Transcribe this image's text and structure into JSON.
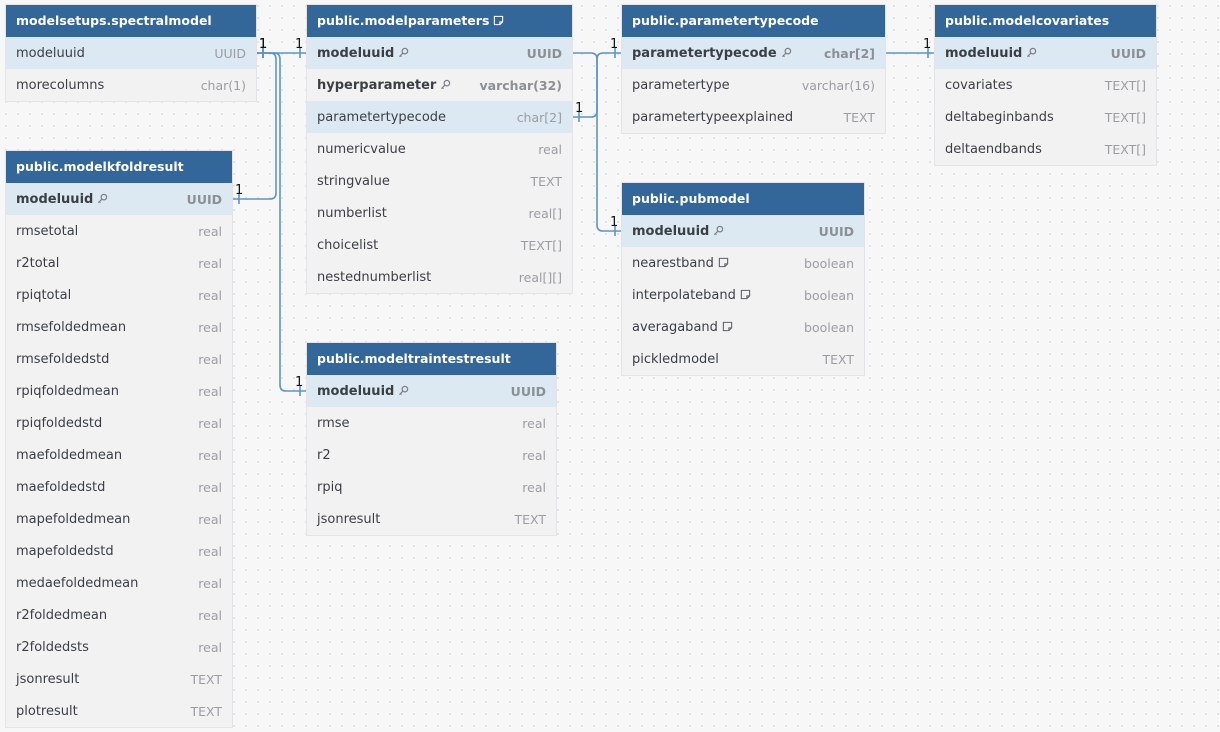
{
  "colors": {
    "header": "#336699",
    "key_row": "#dde9f2",
    "line": "#5b95c8"
  },
  "tables": [
    {
      "id": "spectralmodel",
      "title": "modelsetups.spectralmodel",
      "note": false,
      "columns": [
        {
          "name": "modeluuid",
          "type": "UUID",
          "key": false,
          "bold": false,
          "highlight": true,
          "note": false
        },
        {
          "name": "morecolumns",
          "type": "char(1)",
          "key": false,
          "bold": false,
          "highlight": false,
          "note": false
        }
      ]
    },
    {
      "id": "modelparameters",
      "title": "public.modelparameters",
      "note": true,
      "columns": [
        {
          "name": "modeluuid",
          "type": "UUID",
          "key": true,
          "bold": true,
          "highlight": true,
          "note": false
        },
        {
          "name": "hyperparameter",
          "type": "varchar(32)",
          "key": true,
          "bold": true,
          "highlight": false,
          "note": false
        },
        {
          "name": "parametertypecode",
          "type": "char[2]",
          "key": false,
          "bold": false,
          "highlight": true,
          "note": false
        },
        {
          "name": "numericvalue",
          "type": "real",
          "key": false,
          "bold": false,
          "highlight": false,
          "note": false
        },
        {
          "name": "stringvalue",
          "type": "TEXT",
          "key": false,
          "bold": false,
          "highlight": false,
          "note": false
        },
        {
          "name": "numberlist",
          "type": "real[]",
          "key": false,
          "bold": false,
          "highlight": false,
          "note": false
        },
        {
          "name": "choicelist",
          "type": "TEXT[]",
          "key": false,
          "bold": false,
          "highlight": false,
          "note": false
        },
        {
          "name": "nestednumberlist",
          "type": "real[][]",
          "key": false,
          "bold": false,
          "highlight": false,
          "note": false
        }
      ]
    },
    {
      "id": "parametertypecode",
      "title": "public.parametertypecode",
      "note": false,
      "columns": [
        {
          "name": "parametertypecode",
          "type": "char[2]",
          "key": true,
          "bold": true,
          "highlight": true,
          "note": false
        },
        {
          "name": "parametertype",
          "type": "varchar(16)",
          "key": false,
          "bold": false,
          "highlight": false,
          "note": false
        },
        {
          "name": "parametertypeexplained",
          "type": "TEXT",
          "key": false,
          "bold": false,
          "highlight": false,
          "note": false
        }
      ]
    },
    {
      "id": "modelcovariates",
      "title": "public.modelcovariates",
      "note": false,
      "columns": [
        {
          "name": "modeluuid",
          "type": "UUID",
          "key": true,
          "bold": true,
          "highlight": true,
          "note": false
        },
        {
          "name": "covariates",
          "type": "TEXT[]",
          "key": false,
          "bold": false,
          "highlight": false,
          "note": false
        },
        {
          "name": "deltabeginbands",
          "type": "TEXT[]",
          "key": false,
          "bold": false,
          "highlight": false,
          "note": false
        },
        {
          "name": "deltaendbands",
          "type": "TEXT[]",
          "key": false,
          "bold": false,
          "highlight": false,
          "note": false
        }
      ]
    },
    {
      "id": "modelkfoldresult",
      "title": "public.modelkfoldresult",
      "note": false,
      "columns": [
        {
          "name": "modeluuid",
          "type": "UUID",
          "key": true,
          "bold": true,
          "highlight": true,
          "note": false
        },
        {
          "name": "rmsetotal",
          "type": "real",
          "key": false,
          "bold": false,
          "highlight": false,
          "note": false
        },
        {
          "name": "r2total",
          "type": "real",
          "key": false,
          "bold": false,
          "highlight": false,
          "note": false
        },
        {
          "name": "rpiqtotal",
          "type": "real",
          "key": false,
          "bold": false,
          "highlight": false,
          "note": false
        },
        {
          "name": "rmsefoldedmean",
          "type": "real",
          "key": false,
          "bold": false,
          "highlight": false,
          "note": false
        },
        {
          "name": "rmsefoldedstd",
          "type": "real",
          "key": false,
          "bold": false,
          "highlight": false,
          "note": false
        },
        {
          "name": "rpiqfoldedmean",
          "type": "real",
          "key": false,
          "bold": false,
          "highlight": false,
          "note": false
        },
        {
          "name": "rpiqfoldedstd",
          "type": "real",
          "key": false,
          "bold": false,
          "highlight": false,
          "note": false
        },
        {
          "name": "maefoldedmean",
          "type": "real",
          "key": false,
          "bold": false,
          "highlight": false,
          "note": false
        },
        {
          "name": "maefoldedstd",
          "type": "real",
          "key": false,
          "bold": false,
          "highlight": false,
          "note": false
        },
        {
          "name": "mapefoldedmean",
          "type": "real",
          "key": false,
          "bold": false,
          "highlight": false,
          "note": false
        },
        {
          "name": "mapefoldedstd",
          "type": "real",
          "key": false,
          "bold": false,
          "highlight": false,
          "note": false
        },
        {
          "name": "medaefoldedmean",
          "type": "real",
          "key": false,
          "bold": false,
          "highlight": false,
          "note": false
        },
        {
          "name": "r2foldedmean",
          "type": "real",
          "key": false,
          "bold": false,
          "highlight": false,
          "note": false
        },
        {
          "name": "r2foldedsts",
          "type": "real",
          "key": false,
          "bold": false,
          "highlight": false,
          "note": false
        },
        {
          "name": "jsonresult",
          "type": "TEXT",
          "key": false,
          "bold": false,
          "highlight": false,
          "note": false
        },
        {
          "name": "plotresult",
          "type": "TEXT",
          "key": false,
          "bold": false,
          "highlight": false,
          "note": false
        }
      ]
    },
    {
      "id": "pubmodel",
      "title": "public.pubmodel",
      "note": false,
      "columns": [
        {
          "name": "modeluuid",
          "type": "UUID",
          "key": true,
          "bold": true,
          "highlight": true,
          "note": false
        },
        {
          "name": "nearestband",
          "type": "boolean",
          "key": false,
          "bold": false,
          "highlight": false,
          "note": true
        },
        {
          "name": "interpolateband",
          "type": "boolean",
          "key": false,
          "bold": false,
          "highlight": false,
          "note": true
        },
        {
          "name": "averagaband",
          "type": "boolean",
          "key": false,
          "bold": false,
          "highlight": false,
          "note": true
        },
        {
          "name": "pickledmodel",
          "type": "TEXT",
          "key": false,
          "bold": false,
          "highlight": false,
          "note": false
        }
      ]
    },
    {
      "id": "modeltraintestresult",
      "title": "public.modeltraintestresult",
      "note": false,
      "columns": [
        {
          "name": "modeluuid",
          "type": "UUID",
          "key": true,
          "bold": true,
          "highlight": true,
          "note": false
        },
        {
          "name": "rmse",
          "type": "real",
          "key": false,
          "bold": false,
          "highlight": false,
          "note": false
        },
        {
          "name": "r2",
          "type": "real",
          "key": false,
          "bold": false,
          "highlight": false,
          "note": false
        },
        {
          "name": "rpiq",
          "type": "real",
          "key": false,
          "bold": false,
          "highlight": false,
          "note": false
        },
        {
          "name": "jsonresult",
          "type": "TEXT",
          "key": false,
          "bold": false,
          "highlight": false,
          "note": false
        }
      ]
    }
  ],
  "relations": [
    {
      "from": "spectralmodel",
      "from_col": "modeluuid",
      "to": "modelparameters",
      "to_col": "modeluuid",
      "from_card": "1",
      "to_card": "1"
    },
    {
      "from": "spectralmodel",
      "from_col": "modeluuid",
      "to": "modelkfoldresult",
      "to_col": "modeluuid",
      "from_card": "1",
      "to_card": "1"
    },
    {
      "from": "spectralmodel",
      "from_col": "modeluuid",
      "to": "modeltraintestresult",
      "to_col": "modeluuid",
      "from_card": "1",
      "to_card": "1"
    },
    {
      "from": "modelparameters",
      "from_col": "parametertypecode",
      "to": "parametertypecode",
      "to_col": "parametertypecode",
      "from_card": "1",
      "to_card": "1"
    },
    {
      "from": "modelparameters",
      "from_col": "modeluuid",
      "to": "pubmodel",
      "to_col": "modeluuid",
      "from_card": "",
      "to_card": "1"
    },
    {
      "from": "parametertypecode",
      "from_col": "parametertypecode",
      "to": "modelcovariates",
      "to_col": "modeluuid",
      "from_card": "",
      "to_card": "1"
    }
  ]
}
